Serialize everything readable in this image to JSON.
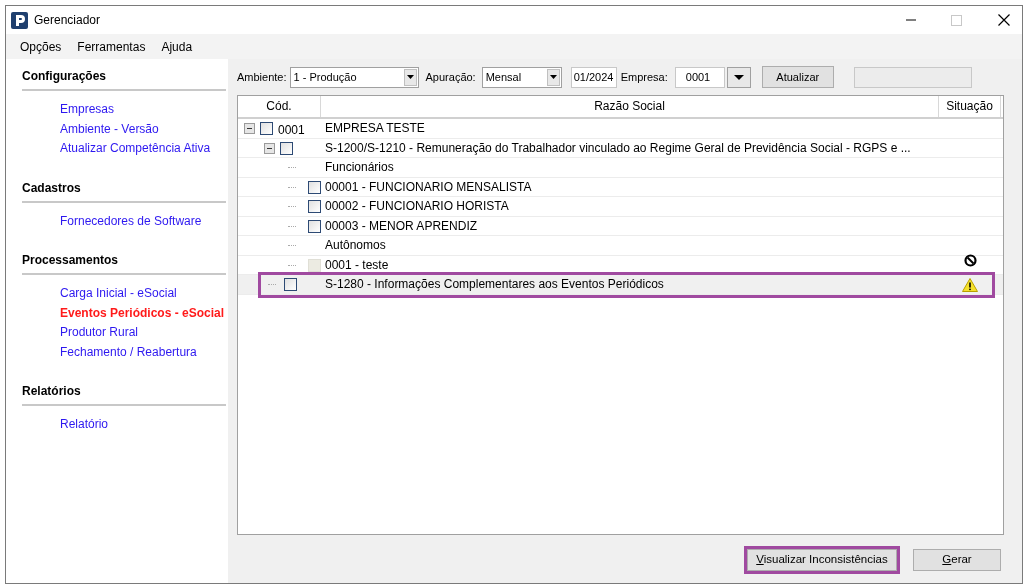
{
  "window": {
    "title": "Gerenciador"
  },
  "menu": [
    "Opções",
    "Ferramentas",
    "Ajuda"
  ],
  "sidebar": {
    "sections": [
      {
        "title": "Configurações",
        "items": [
          {
            "label": "Empresas",
            "selected": false
          },
          {
            "label": "Ambiente - Versão",
            "selected": false
          },
          {
            "label": "Atualizar Competência Ativa",
            "selected": false
          }
        ]
      },
      {
        "title": "Cadastros",
        "items": [
          {
            "label": "Fornecedores de Software",
            "selected": false
          }
        ]
      },
      {
        "title": "Processamentos",
        "items": [
          {
            "label": "Carga Inicial - eSocial",
            "selected": false
          },
          {
            "label": "Eventos Periódicos - eSocial",
            "selected": true
          },
          {
            "label": "Produtor Rural",
            "selected": false
          },
          {
            "label": "Fechamento / Reabertura",
            "selected": false
          }
        ]
      },
      {
        "title": "Relatórios",
        "items": [
          {
            "label": "Relatório",
            "selected": false
          }
        ]
      }
    ]
  },
  "toolbar": {
    "ambiente_label": "Ambiente:",
    "ambiente": "1 - Produção",
    "apuracao_label": "Apuração:",
    "apuracao": "Mensal",
    "period": "01/2024",
    "empresa_label": "Empresa:",
    "empresa": "0001",
    "refresh_button": "Atualizar"
  },
  "tree": {
    "columns": [
      "Cód.",
      "Razão Social",
      "Situação"
    ],
    "rows": [
      {
        "kind": "checkbox",
        "code": "0001",
        "name": "EMPRESA TESTE",
        "expanded": true,
        "checked": false,
        "selected": false,
        "children": [
          {
            "kind": "checkbox",
            "name": "S-1200/S-1210 - Remuneração do Trabalhador vinculado ao Regime Geral de Previdência Social - RGPS e ...",
            "expanded": true,
            "checked": false,
            "selected": false,
            "children": [
              {
                "kind": "label",
                "name": "Funcionários",
                "selected": false
              },
              {
                "kind": "checkbox",
                "name": "00001 - FUNCIONARIO MENSALISTA",
                "checked": false,
                "selected": false
              },
              {
                "kind": "checkbox",
                "name": "00002 - FUNCIONARIO HORISTA",
                "checked": false,
                "selected": false
              },
              {
                "kind": "checkbox",
                "name": "00003 - MENOR APRENDIZ",
                "checked": false,
                "selected": false
              },
              {
                "kind": "label",
                "name": "Autônomos",
                "selected": false
              },
              {
                "kind": "checkbox",
                "name": "0001 - teste",
                "checked": false,
                "disabled": true,
                "selected": false,
                "situation": {
                  "kind": "blocked"
                }
              }
            ]
          },
          {
            "kind": "checkbox",
            "name": "S-1280 - Informações Complementares aos Eventos Periódicos",
            "checked": false,
            "selected": true,
            "highlighted": true,
            "situation": {
              "kind": "warning"
            }
          }
        ]
      }
    ]
  },
  "buttons": [
    {
      "label": "Visualizar Inconsistências",
      "highlighted": true,
      "mnemonic": true
    },
    {
      "label": "Gerar",
      "highlighted": false,
      "mnemonic": true
    }
  ]
}
